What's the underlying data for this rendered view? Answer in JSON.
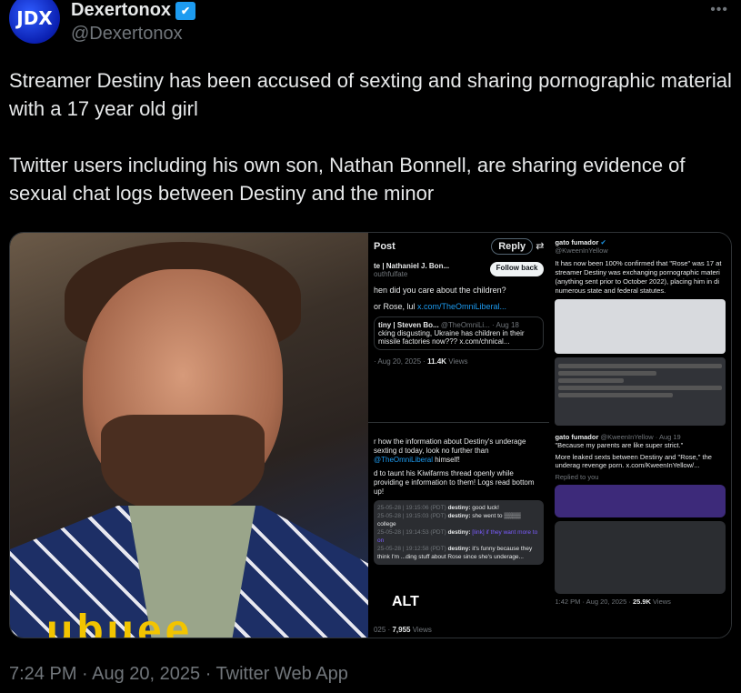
{
  "author": {
    "name": "Dexertonox",
    "handle": "@Dexertonox",
    "avatar_text": "JDX",
    "verified_icon": "twitter-bird-verified-icon"
  },
  "more_label": "•••",
  "tweet": {
    "paragraphs": [
      "Streamer Destiny has been accused of sexting and sharing pornographic material with a 17 year old girl",
      "Twitter users including his own son, Nathan Bonnell, are sharing evidence of sexual chat logs between Destiny and the minor"
    ]
  },
  "media": {
    "alt_label": "ALT",
    "photo_caption": "ubuee",
    "post1": {
      "title": "Post",
      "reply": "Reply",
      "author": "te | Nathaniel J. Bon...",
      "handle": "outhfulfate",
      "follow": "Follow back",
      "text1": "hen did you care about the children?",
      "text2": "or Rose, lul ",
      "link": "x.com/TheOmniLiberal...",
      "quote_author": "tiny | Steven Bo...",
      "quote_handle": "@TheOmniLi... · Aug 18",
      "quote_text": "cking disgusting, Ukraine has children in their missile factories now??? x.com/chnical...",
      "meta": "· Aug 20, 2025 · ",
      "views": "11.4K",
      "views_label": " Views"
    },
    "post2": {
      "text1": "r how the information about Destiny's underage sexting d today, look no further than ",
      "mention": "@TheOmniLiberal",
      "text1b": " himself!",
      "text2": "d to taunt his Kiwifarms thread openly while providing e information to them! Logs read bottom up!",
      "logs": [
        {
          "ts": "25-05-28 | 19:15:06 (PDT)",
          "user": "destiny:",
          "msg": "good luck!"
        },
        {
          "ts": "25-05-28 | 19:15:03 (PDT)",
          "user": "destiny:",
          "msg": "she went to ▒▒▒▒ college"
        },
        {
          "ts": "25-05-28 | 19:14:53 (PDT)",
          "user": "destiny:",
          "msg": "[link] if they want more to on"
        },
        {
          "ts": "25-05-28 | 19:12:58 (PDT)",
          "user": "destiny:",
          "msg": "it's funny because they think I'm ...ding stuff about Rose since she's underage..."
        }
      ],
      "meta": "025 · ",
      "views": "7,955",
      "views_label": " Views"
    },
    "post3": {
      "author": "gato fumador",
      "handle": "@KweenInYellow",
      "text": "It has now been 100% confirmed that \"Rose\" was 17 at streamer Destiny was exchanging pornographic materi (anything sent prior to October 2022), placing him in di numerous state and federal statutes."
    },
    "post4": {
      "author": "gato fumador",
      "handle": "@KweenInYellow · Aug 19",
      "text1": "\"Because my parents are like super strict.\"",
      "text2": "More leaked sexts between Destiny and \"Rose,\" the underag revenge porn. x.com/KweenInYellow/...",
      "replied": "Replied to you",
      "meta": "1:42 PM · Aug 20, 2025 · ",
      "views": "25.9K",
      "views_label": " Views"
    }
  },
  "timestamp": "7:24 PM · Aug 20, 2025 · Twitter Web App"
}
